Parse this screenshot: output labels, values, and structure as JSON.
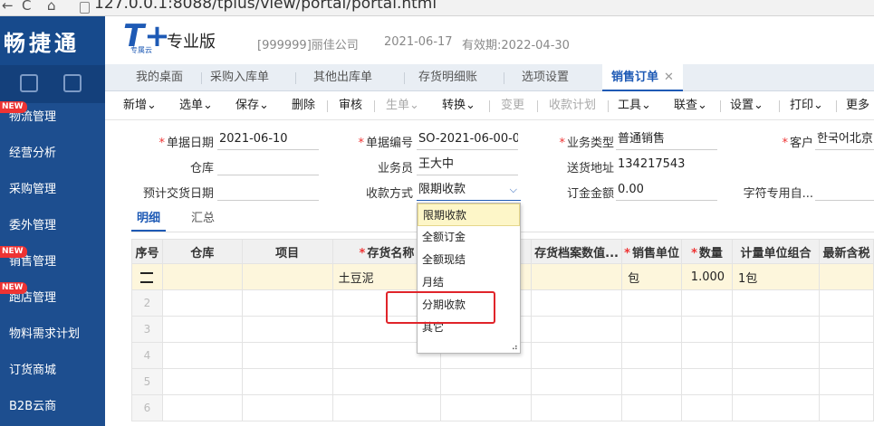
{
  "browser": {
    "url": "127.0.0.1:8088/tplus/view/portal/portal.html"
  },
  "sidebar": {
    "brand": "畅捷通",
    "new_badge": "NEW",
    "items": [
      {
        "label": "物流管理",
        "is_new": true
      },
      {
        "label": "经营分析",
        "is_new": false
      },
      {
        "label": "采购管理",
        "is_new": false
      },
      {
        "label": "委外管理",
        "is_new": false
      },
      {
        "label": "销售管理",
        "is_new": true
      },
      {
        "label": "跑店管理",
        "is_new": true
      },
      {
        "label": "物料需求计划",
        "is_new": false
      },
      {
        "label": "订货商城",
        "is_new": false
      },
      {
        "label": "B2B云商",
        "is_new": false
      }
    ]
  },
  "header": {
    "logo": "T+",
    "logo_sub": "专属云",
    "edition": "专业版",
    "company": "[999999]丽佳公司",
    "date": "2021-06-17",
    "expiry": "有效期:2022-04-30"
  },
  "tabs": [
    {
      "label": "我的桌面"
    },
    {
      "label": "采购入库单"
    },
    {
      "label": "其他出库单"
    },
    {
      "label": "存货明细账"
    },
    {
      "label": "选项设置"
    },
    {
      "label": "销售订单",
      "active": true
    }
  ],
  "toolbar": {
    "items": [
      {
        "label": "新增⌄"
      },
      {
        "label": "选单⌄"
      },
      {
        "label": "保存⌄"
      },
      {
        "label": "删除"
      },
      {
        "label": "审核"
      },
      {
        "label": "生单⌄",
        "disabled": true
      },
      {
        "label": "转换⌄"
      },
      {
        "label": "变更",
        "disabled": true
      },
      {
        "label": "收款计划",
        "disabled": true
      },
      {
        "label": "工具⌄"
      },
      {
        "label": "联查⌄"
      },
      {
        "label": "设置⌄"
      },
      {
        "label": "打印⌄"
      },
      {
        "label": "更多"
      }
    ]
  },
  "form": {
    "doc_date_label": "单据日期",
    "doc_date": "2021-06-10",
    "doc_no_label": "单据编号",
    "doc_no": "SO-2021-06-00-0...",
    "biz_type_label": "业务类型",
    "biz_type": "普通销售",
    "customer_label": "客户",
    "customer": "한국어北京",
    "warehouse_label": "仓库",
    "warehouse": "",
    "salesman_label": "业务员",
    "salesman": "王大中",
    "ship_addr_label": "送货地址",
    "ship_addr": "134217543",
    "delivery_date_label": "预计交货日期",
    "delivery_date": "",
    "pay_method_label": "收款方式",
    "pay_method": "限期收款",
    "deposit_label": "订金金额",
    "deposit": "0.00",
    "custom_label": "字符专用自...",
    "custom": ""
  },
  "subtabs": [
    {
      "label": "明细",
      "active": true
    },
    {
      "label": "汇总"
    }
  ],
  "grid": {
    "headers": [
      "序号",
      "仓库",
      "项目",
      "存货名称",
      "",
      "存货档案数值...",
      "销售单位",
      "数量",
      "计量单位组合",
      "最新含税"
    ],
    "required": [
      false,
      false,
      false,
      true,
      false,
      false,
      true,
      true,
      false,
      false
    ],
    "rows": [
      {
        "idx": "",
        "warehouse": "",
        "project": "",
        "item": "土豆泥",
        "unit": "包",
        "qty": "1.000",
        "combo": "1包",
        "selected": true
      },
      {
        "idx": "2"
      },
      {
        "idx": "3"
      },
      {
        "idx": "4"
      },
      {
        "idx": "5"
      },
      {
        "idx": "6"
      }
    ]
  },
  "dropdown": {
    "options": [
      "限期收款",
      "全额订金",
      "全额现结",
      "月结",
      "分期收款",
      "其它"
    ],
    "selected_index": 0,
    "highlighted_index": 4
  },
  "colors": {
    "sidebar": "#1d4e8f",
    "accent": "#1e5ab5",
    "highlight": "#e0242a"
  }
}
